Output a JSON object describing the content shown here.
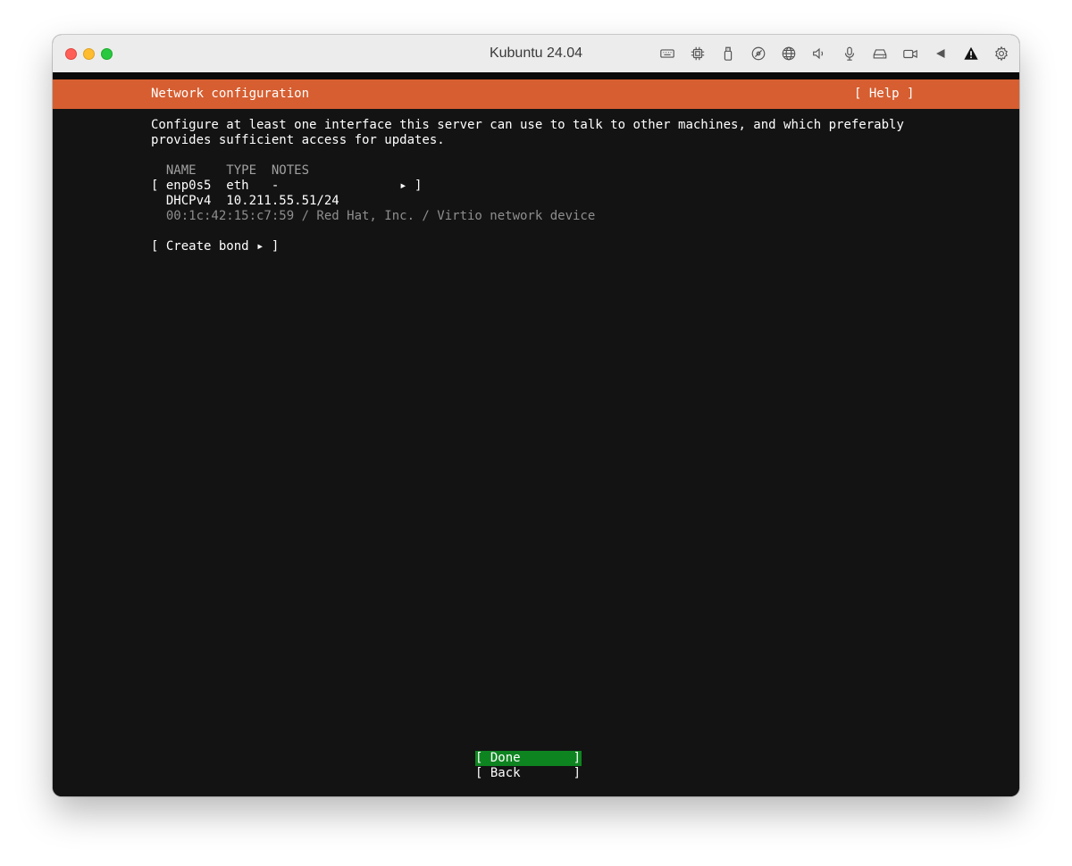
{
  "window": {
    "title": "Kubuntu 24.04",
    "toolbar_icons": [
      "keyboard-icon",
      "cpu-icon",
      "usb-icon",
      "disc-icon",
      "network-globe-icon",
      "speaker-icon",
      "microphone-icon",
      "drive-icon",
      "camera-icon",
      "arrow-left-icon",
      "warning-icon",
      "gear-icon"
    ]
  },
  "installer": {
    "header_title": "Network configuration",
    "help_button": "[ Help ]",
    "description_line1": "Configure at least one interface this server can use to talk to other machines, and which preferably",
    "description_line2": "provides sufficient access for updates.",
    "table": {
      "header": "  NAME    TYPE  NOTES",
      "row_main": "[ enp0s5  eth   -                ▸ ]",
      "row_dhcp": "  DHCPv4  10.211.55.51/24",
      "row_hw": "  00:1c:42:15:c7:59 / Red Hat, Inc. / Virtio network device"
    },
    "create_bond": "[ Create bond ▸ ]",
    "done_button": "[ Done       ]",
    "back_button": "[ Back       ]"
  },
  "colors": {
    "header_bg": "#d65e31",
    "screen_bg": "#131313",
    "done_bg": "#0e8420"
  }
}
